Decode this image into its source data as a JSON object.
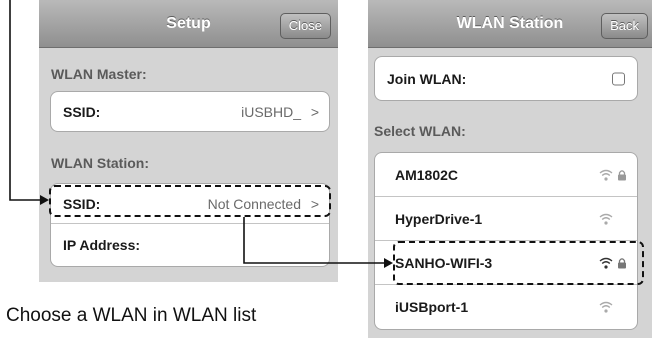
{
  "setup": {
    "title": "Setup",
    "close_label": "Close",
    "master_label": "WLAN Master:",
    "master_ssid_label": "SSID:",
    "master_ssid_value": "iUSBHD_",
    "station_label": "WLAN Station:",
    "station_ssid_label": "SSID:",
    "station_ssid_value": "Not Connected",
    "ip_label": "IP Address:",
    "chevron": ">"
  },
  "station": {
    "title": "WLAN Station",
    "back_label": "Back",
    "join_label": "Join WLAN:",
    "join_checked": false,
    "select_label": "Select WLAN:",
    "networks": [
      {
        "name": "AM1802C",
        "icon": "wifi-icon",
        "locked": true
      },
      {
        "name": "HyperDrive-1",
        "icon": "wifi-icon",
        "locked": false
      },
      {
        "name": "SANHO-WIFI-3",
        "icon": "wifi-icon",
        "locked": true
      },
      {
        "name": "iUSBport-1",
        "icon": "wifi-icon",
        "locked": false
      }
    ]
  },
  "caption": "Choose a WLAN in WLAN list",
  "colors": {
    "navbar": "#9f9f9f",
    "background": "#d4d4d4",
    "annotation": "#111111"
  }
}
